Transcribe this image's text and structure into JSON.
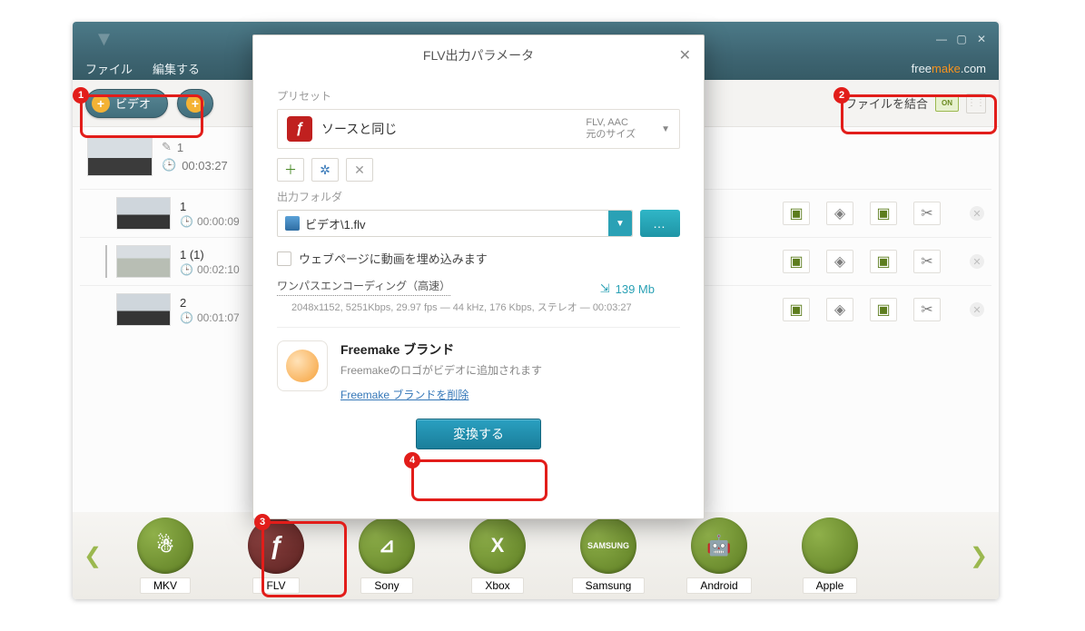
{
  "window": {
    "min": "—",
    "max": "▢",
    "close": "✕"
  },
  "menu": {
    "file": "ファイル",
    "edit": "編集する",
    "brand_pre": "free",
    "brand_mid": "make",
    "brand_suf": ".com"
  },
  "toolbar": {
    "add_video": "ビデオ",
    "join_label": "ファイルを結合",
    "join_state": "ON"
  },
  "master": {
    "name": "1",
    "duration": "00:03:27"
  },
  "rows": [
    {
      "name": "1",
      "duration": "00:00:09"
    },
    {
      "name": "1 (1)",
      "duration": "00:02:10"
    },
    {
      "name": "2",
      "duration": "00:01:07"
    }
  ],
  "formats": [
    {
      "label": "MKV",
      "glyph": "☃"
    },
    {
      "label": "FLV",
      "glyph": "ƒ"
    },
    {
      "label": "Sony",
      "glyph": "⊿"
    },
    {
      "label": "Xbox",
      "glyph": "X"
    },
    {
      "label": "Samsung",
      "glyph": "SAMSUNG"
    },
    {
      "label": "Android",
      "glyph": "🤖"
    },
    {
      "label": "Apple",
      "glyph": ""
    }
  ],
  "modal": {
    "title": "FLV出力パラメータ",
    "preset_section": "プリセット",
    "preset_name": "ソースと同じ",
    "preset_meta1": "FLV, AAC",
    "preset_meta2": "元のサイズ",
    "out_section": "出力フォルダ",
    "out_path": "ビデオ\\1.flv",
    "embed_label": "ウェブページに動画を埋め込みます",
    "encoding_link": "ワンパスエンコーディング（高速）",
    "encoding_detail": "2048x1152, 5251Kbps, 29.97 fps — 44 kHz, 176 Kbps, ステレオ — 00:03:27",
    "size": "139 Mb",
    "brand_title": "Freemake ブランド",
    "brand_sub": "Freemakeのロゴがビデオに追加されます",
    "brand_remove": "Freemake ブランドを削除",
    "convert": "変換する"
  },
  "callouts": {
    "1": "1",
    "2": "2",
    "3": "3",
    "4": "4"
  }
}
